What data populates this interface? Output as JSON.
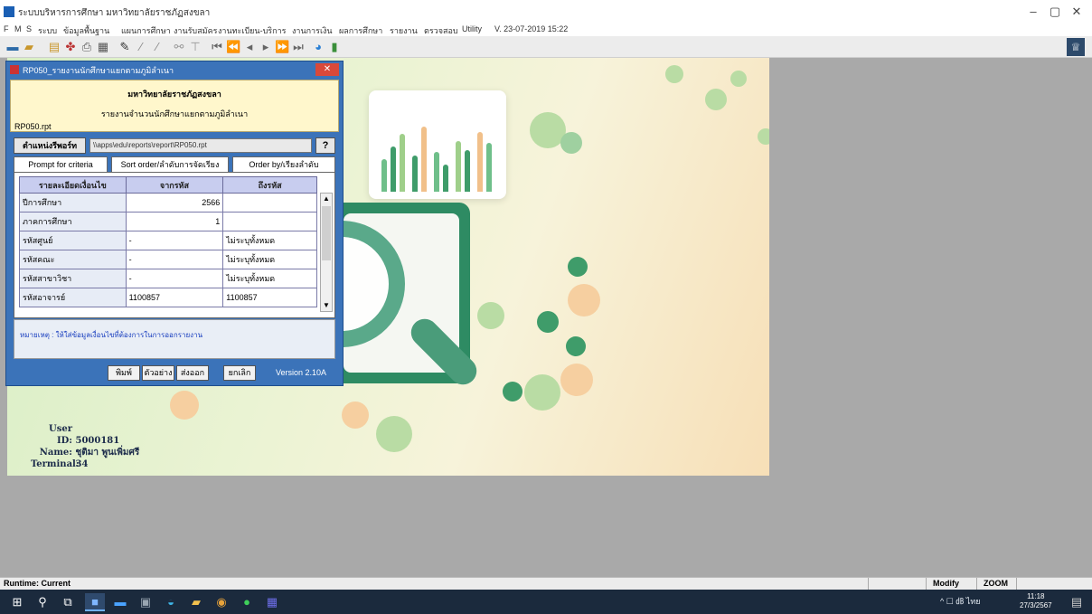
{
  "window": {
    "title": "ระบบบริหารการศึกษา มหาวิทยาลัยราชภัฏสงขลา",
    "controls": {
      "minimize": "–",
      "maximize": "▢",
      "close": "✕"
    }
  },
  "menubar": {
    "items": [
      "F",
      "M",
      "S",
      "ระบบ",
      "ข้อมูลพื้นฐาน",
      "แผนการศึกษา",
      "งานรับสมัคร",
      "งานทะเบียน-บริการ",
      "งานการเงิน",
      "ผลการศึกษา",
      "รายงาน",
      "ตรวจสอบ",
      "Utility",
      "V. 23-07-2019 15:22"
    ]
  },
  "toolbar": {
    "icons": [
      "save-icon",
      "folder-icon",
      "book-icon",
      "tree-icon",
      "print-icon",
      "edit-icon",
      "pencil-icon",
      "pencil-alt-icon",
      "binoculars-icon",
      "filter-icon",
      "first-icon",
      "prev-page-icon",
      "prev-icon",
      "next-icon",
      "next-page-icon",
      "last-icon",
      "globe-icon",
      "person-icon"
    ]
  },
  "dialog": {
    "title": "RP050_รายงานนักศึกษาแยกตามภูมิลำเนา",
    "close_label": "✕",
    "header_line1": "มหาวิทยาลัยราชภัฏสงขลา",
    "header_line2": "รายงานจำนวนนักศึกษาแยกตามภูมิลำเนา",
    "report_file": "RP050.rpt",
    "path_button": "ตำแหน่งรีพอร์ท",
    "path_value": "\\\\apps\\edu\\reports\\report\\RP050.rpt",
    "help_button": "?",
    "tabs": [
      "Prompt for criteria",
      "Sort order/ลำดับการจัดเรียง",
      "Order by/เรียงลำดับ"
    ],
    "grid": {
      "headers": [
        "รายละเอียดเงื่อนไข",
        "จากรหัส",
        "ถึงรหัส"
      ],
      "rows": [
        {
          "label": "ปีการศึกษา",
          "from": "2566",
          "to": ""
        },
        {
          "label": "ภาคการศึกษา",
          "from": "1",
          "to": ""
        },
        {
          "label": "รหัสศูนย์",
          "from": "-",
          "to": "ไม่ระบุทั้งหมด"
        },
        {
          "label": "รหัสคณะ",
          "from": "-",
          "to": "ไม่ระบุทั้งหมด"
        },
        {
          "label": "รหัสสาขาวิชา",
          "from": "-",
          "to": "ไม่ระบุทั้งหมด"
        },
        {
          "label": "รหัสอาจารย์",
          "from": "1100857",
          "to": "1100857"
        }
      ]
    },
    "note": "หมายเหตุ : ให้ใส่ข้อมูลเงื่อนไขที่ต้องการในการออกรายงาน",
    "buttons": {
      "preview": "พิมพ์",
      "print": "ตัวอย่าง",
      "export": "ส่งออก",
      "cancel": "ยกเลิก"
    },
    "version": "Version 2.10A"
  },
  "user": {
    "id_label": "User ID:",
    "id_value": "5000181",
    "name_label": "Name:",
    "name_value": "ชุติมา พูนเพิ่มศรี",
    "terminal_label": "Terminal:",
    "terminal_value": "34"
  },
  "statusbar": {
    "left": "Runtime: Current",
    "modify": "Modify",
    "zoom": "ZOOM"
  },
  "taskbar": {
    "icons": [
      "windows-start-icon",
      "search-icon",
      "task-view-icon",
      "app-edu-icon",
      "mail-icon",
      "calculator-icon",
      "edge-icon",
      "explorer-icon",
      "chrome-icon",
      "line-icon",
      "onenote-icon"
    ],
    "tray": "^ ☐ ㏈ ไทย",
    "time": "11:18",
    "date": "27/3/2567"
  }
}
